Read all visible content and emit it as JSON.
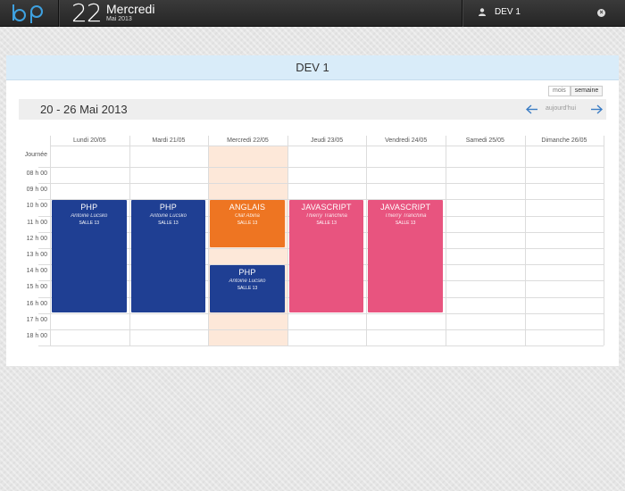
{
  "topbar": {
    "logo_text": "bp",
    "day_number": "22",
    "weekday": "Mercredi",
    "month_year": "Mai 2013",
    "user_name": "DEV 1",
    "close_glyph": "×"
  },
  "panel": {
    "title": "DEV 1",
    "view_buttons": [
      "mois",
      "semaine"
    ],
    "range_title": "20 - 26 Mai 2013",
    "today_label": "aujourd'hui"
  },
  "calendar": {
    "days": [
      "Lundi 20/05",
      "Mardi 21/05",
      "Mercredi 22/05",
      "Jeudi 23/05",
      "Vendredi 24/05",
      "Samedi 25/05",
      "Dimanche 26/05"
    ],
    "allday_label": "Journée",
    "hours": [
      "08 h 00",
      "09 h 00",
      "10 h 00",
      "11 h 00",
      "12 h 00",
      "13 h 00",
      "14 h 00",
      "15 h 00",
      "16 h 00",
      "17 h 00",
      "18 h 00"
    ],
    "today_index": 2,
    "events": [
      {
        "title": "PHP",
        "teacher": "Antoine Lucsko",
        "room": "SALLE 13",
        "color": "#1f3f93"
      },
      {
        "title": "PHP",
        "teacher": "Antoine Lucsko",
        "room": "SALLE 13",
        "color": "#1f3f93"
      },
      {
        "title": "ANGLAIS",
        "teacher": "Olaf Abina",
        "room": "SALLE 13",
        "color": "#ee7522"
      },
      {
        "title": "PHP",
        "teacher": "Antoine Lucsko",
        "room": "SALLE 13",
        "color": "#1f3f93"
      },
      {
        "title": "JAVASCRIPT",
        "teacher": "Thierry Tranchina",
        "room": "SALLE 13",
        "color": "#e8547f"
      },
      {
        "title": "JAVASCRIPT",
        "teacher": "Thierry Tranchina",
        "room": "SALLE 13",
        "color": "#e8547f"
      }
    ]
  },
  "colors": {
    "accent_blue": "#1f3f93",
    "accent_orange": "#ee7522",
    "accent_pink": "#e8547f",
    "header_band": "#d9ecf9",
    "today_highlight": "#fde8d9",
    "nav_arrow": "#3a7cc4"
  },
  "icons": {
    "user": "user-icon",
    "close": "close-icon",
    "prev": "arrow-left-icon",
    "next": "arrow-right-icon"
  }
}
